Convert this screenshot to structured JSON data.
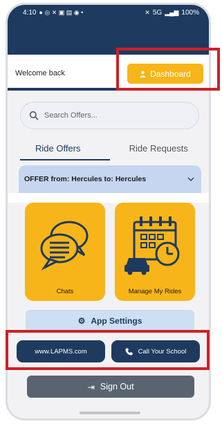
{
  "status_bar": {
    "time": "4:10",
    "network": "5G",
    "battery": "100%"
  },
  "header": {
    "welcome": "Welcome back",
    "dashboard_label": "Dashboard"
  },
  "search": {
    "placeholder": "Search Offers..."
  },
  "tabs": [
    {
      "label": "Ride Offers",
      "active": true
    },
    {
      "label": "Ride Requests",
      "active": false
    }
  ],
  "offer": {
    "label": "OFFER from: Hercules to: Hercules"
  },
  "tiles": [
    {
      "label": "Chats",
      "icon": "chat-bubbles-icon"
    },
    {
      "label": "Manage My Rides",
      "icon": "calendar-car-icon"
    }
  ],
  "settings": {
    "label": "App Settings"
  },
  "links": {
    "website": "www.LAPMS.com",
    "call": "Call Your School"
  },
  "signout": {
    "label": "Sign Out"
  },
  "colors": {
    "navy": "#1e3a5f",
    "accent_yellow": "#f7b519",
    "highlight_red": "#cf2026",
    "offer_blue": "#c6d6f0",
    "settings_blue": "#cddff2",
    "signout_gray": "#5a6470"
  }
}
